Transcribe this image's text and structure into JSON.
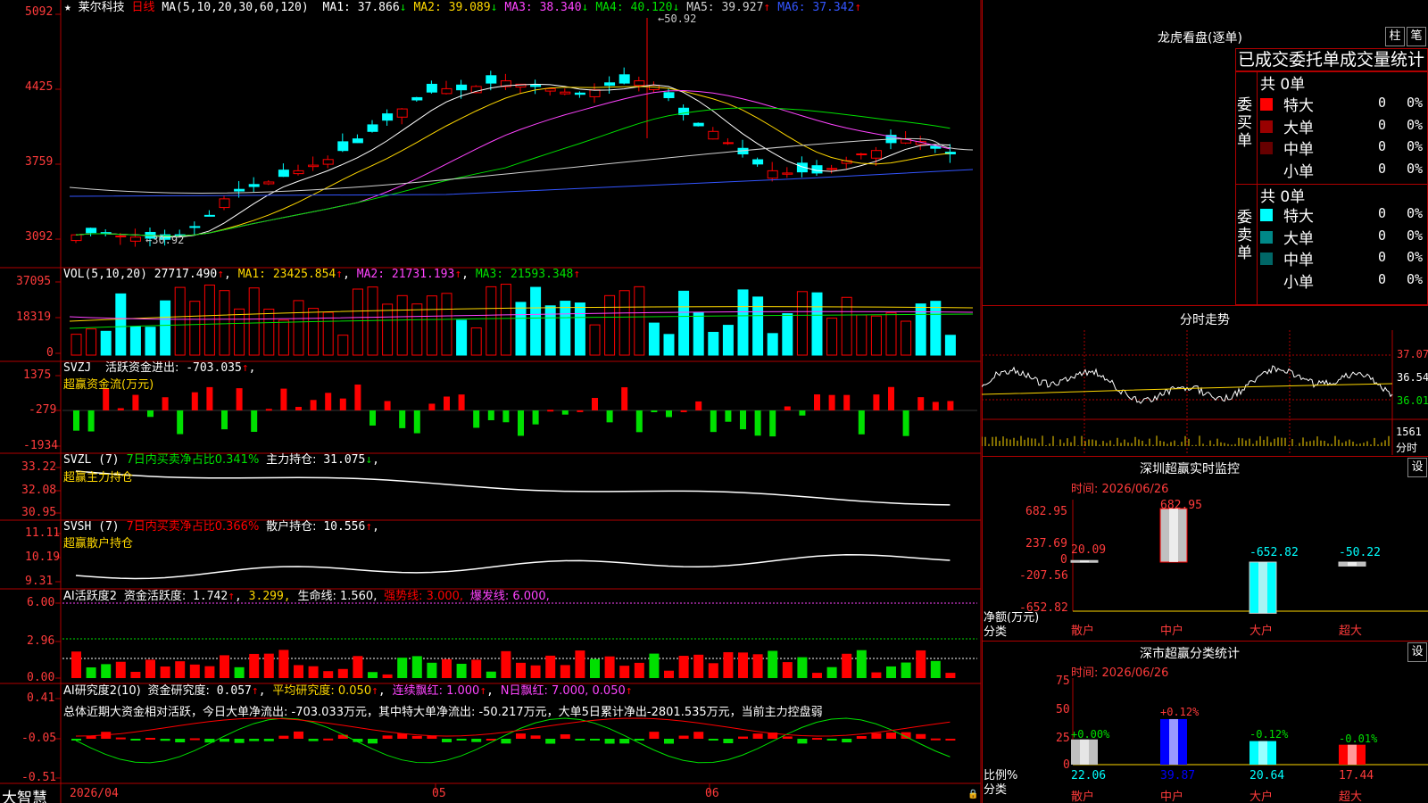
{
  "stock": {
    "name": "莱尔科技",
    "period": "日线",
    "star": "★",
    "ma_params": "MA(5,10,20,30,60,120)"
  },
  "ma_items": [
    {
      "label": "MA1:",
      "value": "37.866",
      "arrow": "↓",
      "color": "#ffffff"
    },
    {
      "label": "MA2:",
      "value": "39.089",
      "arrow": "↓",
      "color": "#ffd800"
    },
    {
      "label": "MA3:",
      "value": "38.340",
      "arrow": "↓",
      "color": "#ff44ff"
    },
    {
      "label": "MA4:",
      "value": "40.120",
      "arrow": "↓",
      "color": "#00e000"
    },
    {
      "label": "MA5:",
      "value": "39.927",
      "arrow": "↑",
      "color": "#d0d0d0"
    },
    {
      "label": "MA6:",
      "value": "37.342",
      "arrow": "↑",
      "color": "#3355ff"
    }
  ],
  "price_axis": [
    "5092",
    "4425",
    "3759",
    "3092"
  ],
  "price_annotations": {
    "high": "50.92",
    "low": "30.92"
  },
  "vol": {
    "title": "VOL(5,10,20)",
    "value": "27717.490",
    "arrow": "↑",
    "ma1": "MA1: 23425.854",
    "ma1_arrow": "↑",
    "ma2": "MA2: 21731.193",
    "ma2_arrow": "↑",
    "ma3": "MA3: 21593.348",
    "ma3_arrow": "↑",
    "axis": [
      "37095",
      "18319",
      "0"
    ]
  },
  "svzj": {
    "title": "SVZJ",
    "label": "活跃资金进出:",
    "value": "-703.035",
    "arrow": "↑",
    "subtitle": "超赢资金流(万元)",
    "axis": [
      "1375",
      "-279",
      "-1934"
    ]
  },
  "svzl": {
    "title": "SVZL (7)",
    "desc": "7日内买卖净占比0.341%",
    "label": "主力持仓:",
    "value": "31.075",
    "arrow": "↓",
    "subtitle": "超赢主力持仓",
    "axis": [
      "33.22",
      "32.08",
      "30.95"
    ]
  },
  "svsh": {
    "title": "SVSH (7)",
    "desc": "7日内买卖净占比0.366%",
    "label": "散户持仓:",
    "value": "10.556",
    "arrow": "↑",
    "subtitle": "超赢散户持仓",
    "axis": [
      "11.11",
      "10.19",
      "9.31"
    ]
  },
  "ai1": {
    "title": "AI活跃度2",
    "label": "资金活跃度:",
    "value": "1.742",
    "arrow": "↑",
    "v2": "3.299,",
    "life": "生命线: 1.560,",
    "strong": "强势线: 3.000,",
    "burst": "爆发线: 6.000,",
    "axis": [
      "6.00",
      "2.96",
      "0.00"
    ]
  },
  "ai2": {
    "title": "AI研究度2(10)",
    "label": "资金研究度:",
    "value": "0.057",
    "arrow": "↑",
    "avg": "平均研究度: 0.050",
    "avg_arrow": "↑",
    "red": "连续飘红: 1.000",
    "red_arrow": "↑",
    "nred": "N日飘红: 7.000, 0.050",
    "nred_arrow": "↑",
    "summary": "总体近期大资金相对活跃，今日大单净流出: -703.033万元，其中特大单净流出: -50.217万元，大单5日累计净出-2801.535万元，当前主力控盘弱",
    "axis": [
      "0.41",
      "-0.05",
      "-0.51"
    ]
  },
  "date_axis": {
    "d1": "2026/04",
    "d2": "05",
    "d3": "06"
  },
  "brand": "大智慧",
  "dragon": {
    "title": "龙虎看盘(逐单)",
    "btn_bar": "柱",
    "btn_pen": "笔",
    "tab_title": "已成交委托单成交量统计",
    "buy_label": "委买单",
    "sell_label": "委卖单",
    "buy_total": "共 0单",
    "sell_total": "共 0单",
    "buy_rows": [
      {
        "name": "特大",
        "count": "0",
        "pct": "0%",
        "color": "#ff0000"
      },
      {
        "name": "大单",
        "count": "0",
        "pct": "0%",
        "color": "#990000"
      },
      {
        "name": "中单",
        "count": "0",
        "pct": "0%",
        "color": "#660000"
      },
      {
        "name": "小单",
        "count": "0",
        "pct": "0%",
        "color": "#000000"
      }
    ],
    "sell_rows": [
      {
        "name": "特大",
        "count": "0",
        "pct": "0%",
        "color": "#00ffff"
      },
      {
        "name": "大单",
        "count": "0",
        "pct": "0%",
        "color": "#008888"
      },
      {
        "name": "中单",
        "count": "0",
        "pct": "0%",
        "color": "#006666"
      },
      {
        "name": "小单",
        "count": "0",
        "pct": "0%",
        "color": "#000000"
      }
    ]
  },
  "intraday": {
    "title": "分时走势",
    "axis": [
      "37.07",
      "36.54",
      "36.01"
    ],
    "vol_axis": [
      "1561"
    ],
    "vol_unit": "分时"
  },
  "szmon": {
    "title": "深圳超赢实时监控",
    "btn": "设",
    "time": "时间: 2026/06/26",
    "axis": [
      "682.95",
      "237.69",
      "0",
      "-207.56",
      "-652.82"
    ],
    "ylabel": "净额(万元)",
    "xlabel": "分类",
    "chart_data": {
      "type": "bar",
      "categories": [
        "散户",
        "中户",
        "大户",
        "超大"
      ],
      "values": [
        20.09,
        682.95,
        -652.82,
        -50.22
      ],
      "value_labels": [
        "20.09",
        "682.95",
        "-652.82",
        "-50.22"
      ],
      "ylabel": "净额(万元)",
      "xlabel": "分类",
      "ylim": [
        -652.82,
        682.95
      ]
    }
  },
  "szcls": {
    "title": "深市超赢分类统计",
    "btn": "设",
    "time": "时间: 2026/06/26",
    "axis": [
      "75",
      "50",
      "25",
      "0"
    ],
    "ylabel": "比例%",
    "xlabel": "分类",
    "chart_data": {
      "type": "bar",
      "categories": [
        "散户",
        "中户",
        "大户",
        "超大"
      ],
      "values": [
        22.06,
        39.87,
        20.64,
        17.44
      ],
      "changes": [
        "+0.00%",
        "+0.12%",
        "-0.12%",
        "-0.01%"
      ],
      "ylabel": "比例%",
      "xlabel": "分类",
      "ylim": [
        0,
        75
      ]
    }
  },
  "colors": {
    "up": "#ff0000",
    "down": "#00ffff",
    "grid": "#b00000",
    "axis_text": "#ff3b3b",
    "yellow": "#ffd800",
    "green": "#00e000",
    "magenta": "#ff44ff"
  }
}
